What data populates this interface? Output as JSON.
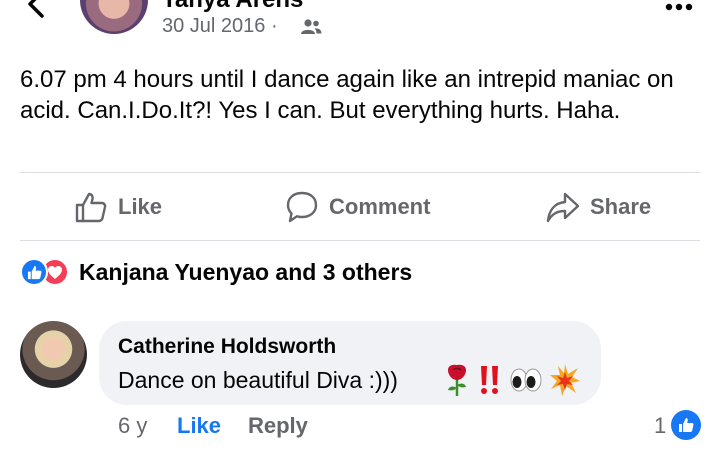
{
  "header": {
    "author_name": "Tanya Arens",
    "date": "30 Jul 2016 ·",
    "audience_icon": "friends-icon",
    "back_icon": "chevron-left-icon",
    "more_icon": "more-dots-icon"
  },
  "post": {
    "text": "6.07 pm 4 hours until I dance again like an intrepid maniac on acid.  Can.I.Do.It?!  Yes I can.  But everything hurts. Haha."
  },
  "actions": {
    "like_label": "Like",
    "comment_label": "Comment",
    "share_label": "Share"
  },
  "reactions": {
    "icons": [
      "like-reaction-icon",
      "love-reaction-icon"
    ],
    "label": "Kanjana Yuenyao and 3 others"
  },
  "comment": {
    "author": "Catherine Holdsworth",
    "text": "Dance on beautiful Diva :)))",
    "emoji_icons": [
      "rose-icon",
      "double-exclamation-icon",
      "eyes-icon",
      "collision-icon"
    ],
    "time": "6 y",
    "like_label": "Like",
    "reply_label": "Reply",
    "like_count": "1"
  },
  "colors": {
    "accent": "#1877f2",
    "love": "#f33e58",
    "muted_text": "#65676b",
    "bubble": "#f0f2f5"
  }
}
